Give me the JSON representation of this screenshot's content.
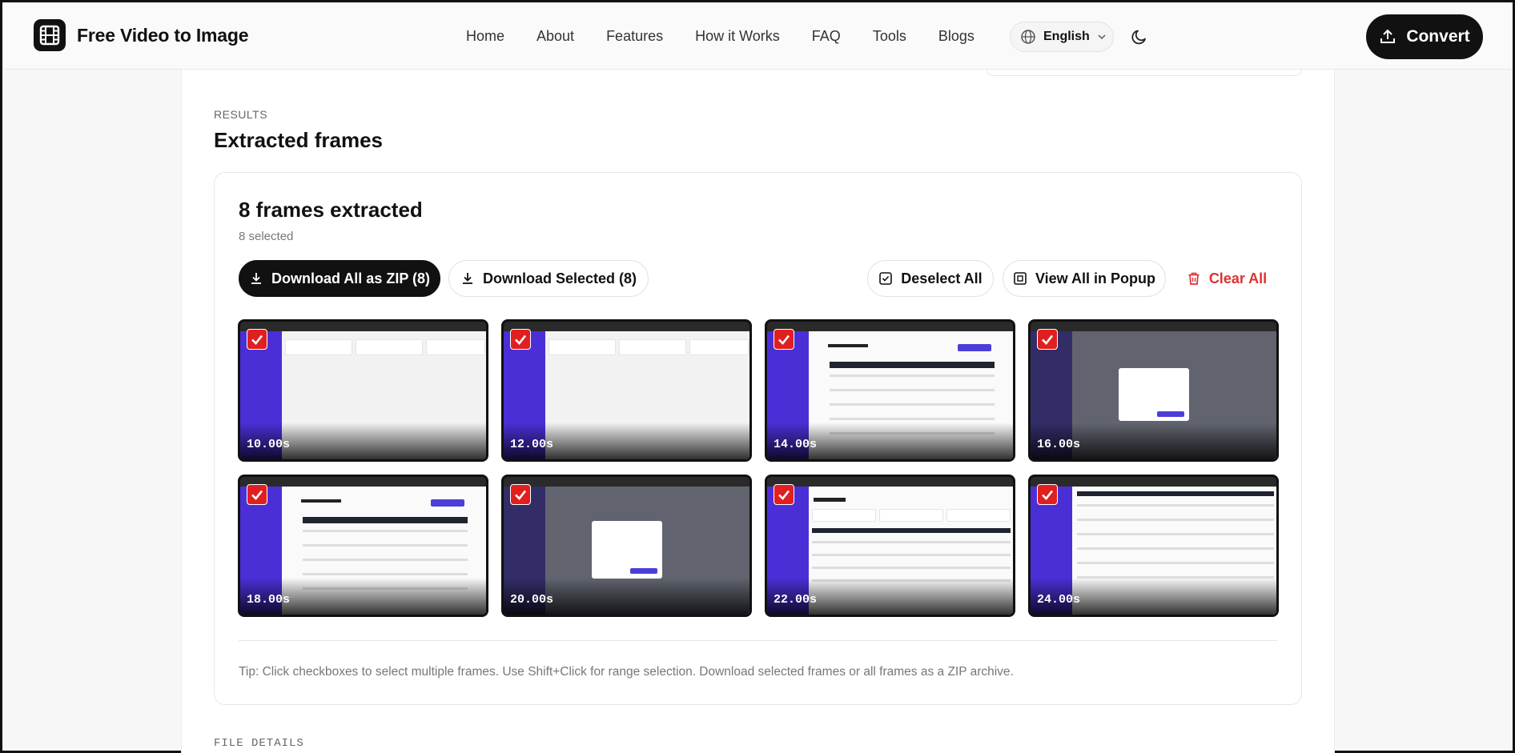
{
  "header": {
    "brand_name": "Free Video to Image",
    "nav": [
      "Home",
      "About",
      "Features",
      "How it Works",
      "FAQ",
      "Tools",
      "Blogs"
    ],
    "language": "English",
    "convert_label": "Convert",
    "icons": {
      "brand": "film-icon",
      "language": "globe-icon",
      "theme": "moon-icon",
      "convert": "upload-icon"
    }
  },
  "results": {
    "section_label": "RESULTS",
    "title": "Extracted frames",
    "frames_count": "8 frames extracted",
    "selected_count": "8 selected",
    "download_all_label": "Download All as ZIP (8)",
    "download_selected_label": "Download Selected (8)",
    "deselect_all_label": "Deselect All",
    "view_popup_label": "View All in Popup",
    "clear_all_label": "Clear All",
    "frames": [
      {
        "time": "10.00s",
        "selected": true
      },
      {
        "time": "12.00s",
        "selected": true
      },
      {
        "time": "14.00s",
        "selected": true
      },
      {
        "time": "16.00s",
        "selected": true
      },
      {
        "time": "18.00s",
        "selected": true
      },
      {
        "time": "20.00s",
        "selected": true
      },
      {
        "time": "22.00s",
        "selected": true
      },
      {
        "time": "24.00s",
        "selected": true
      }
    ],
    "tip": "Tip: Click checkboxes to select multiple frames. Use Shift+Click for range selection. Download selected frames or all frames as a ZIP archive."
  },
  "file_details_label": "FILE DETAILS",
  "colors": {
    "accent": "#111111",
    "danger": "#e03131",
    "checkbox": "#e02020",
    "app_sidebar": "#4b2fd6"
  }
}
